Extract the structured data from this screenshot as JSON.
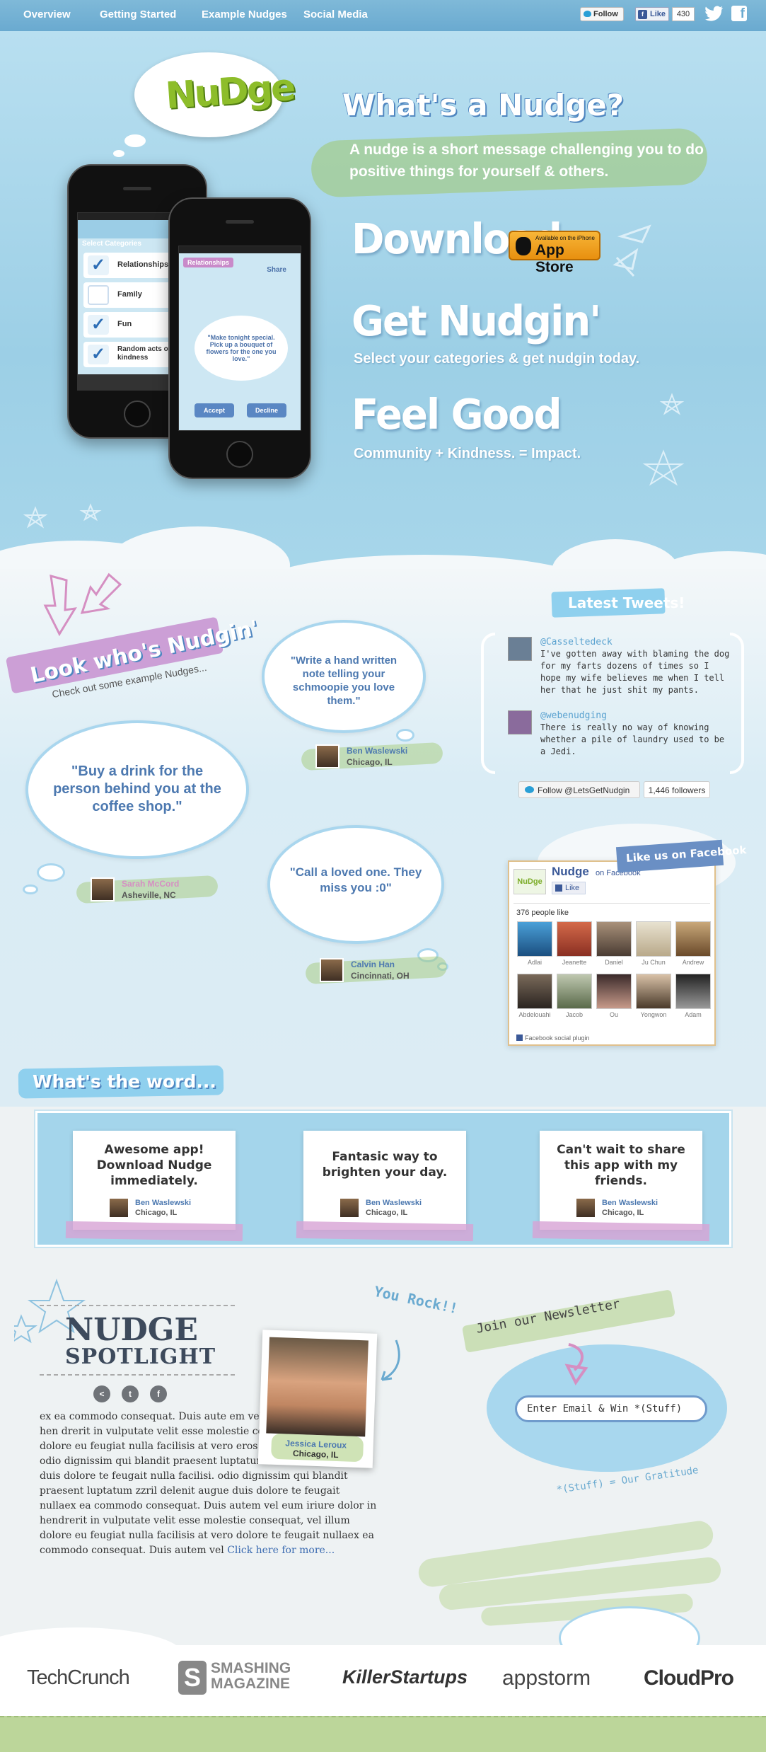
{
  "nav": {
    "items": [
      "Overview",
      "Getting Started",
      "Example Nudges",
      "Social Media"
    ],
    "twitter_follow": "Follow",
    "fb_like": "Like",
    "fb_like_count": "430"
  },
  "hero": {
    "logo": "NuDge",
    "title": "What's a Nudge?",
    "subtitle": "A nudge is a short message challenging you to do positive things for yourself & others.",
    "download": "Download",
    "appstore_small": "Available on the iPhone",
    "appstore_big": "App Store",
    "get_nudgin": "Get Nudgin'",
    "get_nudgin_sub": "Select your categories & get nudgin today.",
    "feel_good": "Feel Good",
    "feel_good_sub": "Community + Kindness. = Impact.",
    "phone1": {
      "header": "Select Categories",
      "categories": [
        "Relationships",
        "Family",
        "Fun",
        "Random acts of kindness"
      ]
    },
    "phone2": {
      "tag": "Relationships",
      "share": "Share",
      "nudge": "\"Make tonight special. Pick up a bouquet of flowers for the one you love.\"",
      "accept": "Accept",
      "decline": "Decline"
    }
  },
  "examples": {
    "title": "Look who's Nudgin'",
    "subtitle": "Check out some example Nudges...",
    "nudges": [
      {
        "text": "\"Write a hand written note telling your schmoopie you love them.\"",
        "name": "Ben Waslewski",
        "location": "Chicago, IL"
      },
      {
        "text": "\"Buy a drink for the person behind you at the coffee shop.\"",
        "name": "Sarah McCord",
        "location": "Asheville, NC"
      },
      {
        "text": "\"Call a loved one. They miss you :0\"",
        "name": "Calvin Han",
        "location": "Cincinnati, OH"
      }
    ]
  },
  "tweets": {
    "title": "Latest Tweets!",
    "items": [
      {
        "handle": "@Casseltedeck",
        "text": "I've gotten away with blaming the dog for my farts dozens of times so I hope my wife believes me when I tell her that he just shit my pants."
      },
      {
        "handle": "@webenudging",
        "text": "There is really no way of knowing whether a pile of laundry used to be a Jedi."
      }
    ],
    "follow_button": "Follow @LetsGetNudgin",
    "followers": "1,446 followers"
  },
  "facebook": {
    "title": "Like us on Facebook",
    "page_name": "Nudge",
    "on_facebook": "on Facebook",
    "like_button": "Like",
    "people_like": "376 people like",
    "fans": [
      "Adlai",
      "Jeanette",
      "Daniel",
      "Ju Chun",
      "Andrew",
      "Abdelouahi",
      "Jacob",
      "Ou",
      "Yongwon",
      "Adam"
    ],
    "plugin": "Facebook social plugin"
  },
  "word": {
    "title": "What's the word...",
    "testimonials": [
      {
        "text": "Awesome app! Download Nudge immediately.",
        "name": "Ben Waslewski",
        "location": "Chicago, IL"
      },
      {
        "text": "Fantasic way to brighten your day.",
        "name": "Ben Waslewski",
        "location": "Chicago, IL"
      },
      {
        "text": "Can't wait to share this app with my friends.",
        "name": "Ben Waslewski",
        "location": "Chicago, IL"
      }
    ]
  },
  "spotlight": {
    "title1": "NUDGE",
    "title2": "SPOTLIGHT",
    "you_rock": "You Rock!!",
    "person_name": "Jessica Leroux",
    "person_location": "Chicago, IL",
    "body": "ex ea commodo consequat. Duis aute em vel eum iriure dolor in hen drerit in vulputate velit esse molestie conse quat, vel illum dolore eu feugiat nulla facilisis at vero eros et accumsan et iusto odio dignissim qui blandit praesent luptatum zzril delenit augue duis dolore te feugait nulla facilisi. odio dignissim qui blandit praesent luptatum zzril delenit augue duis dolore te feugait nullaex ea commodo consequat. Duis autem vel eum iriure dolor in hendrerit in vulputate velit esse molestie consequat, vel illum dolore eu feugiat nulla facilisis at vero dolore te feugait nullaex ea commodo consequat. Duis autem vel",
    "more": "Click here for more..."
  },
  "newsletter": {
    "title": "Join our Newsletter",
    "placeholder": "Enter Email & Win *(Stuff)",
    "note": "*(Stuff) = Our Gratitude"
  },
  "press": [
    "TechCrunch",
    "SMASHING MAGAZINE",
    "KillerStartups",
    "appstorm",
    "CloudPro"
  ]
}
